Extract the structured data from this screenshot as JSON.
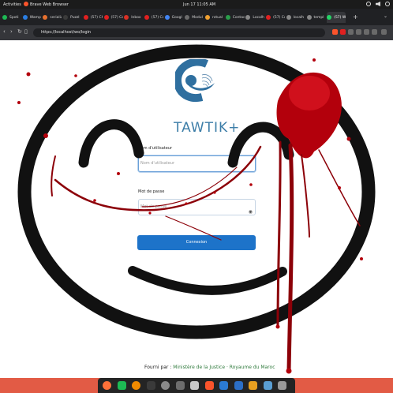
{
  "topbar": {
    "activities": "Activities",
    "app_name": "Brave Web Browser",
    "clock": "Jun 17  11:05 AM"
  },
  "tabs": [
    {
      "label": "Spoti",
      "color": "#1db954"
    },
    {
      "label": "Wamp",
      "color": "#2a7de1"
    },
    {
      "label": "serializ",
      "color": "#e6702e"
    },
    {
      "label": "Puzzl",
      "color": "#3b3b3b"
    },
    {
      "label": "(57) Ch",
      "color": "#e02020"
    },
    {
      "label": "(57) Co",
      "color": "#e02020"
    },
    {
      "label": "Inbox",
      "color": "#d93025"
    },
    {
      "label": "(57) Co",
      "color": "#e02020"
    },
    {
      "label": "Googl",
      "color": "#4285f4"
    },
    {
      "label": "Modul",
      "color": "#6b6b6b"
    },
    {
      "label": "rxtual",
      "color": "#f0a030"
    },
    {
      "label": "Contac",
      "color": "#2a9d4a"
    },
    {
      "label": "Localh",
      "color": "#888888"
    },
    {
      "label": "(57) Cc",
      "color": "#e02020"
    },
    {
      "label": "localh",
      "color": "#888888"
    },
    {
      "label": "templ",
      "color": "#888888"
    },
    {
      "label": "(57) Wh",
      "color": "#25d366"
    }
  ],
  "address": {
    "url": "https://localhost/wo/login"
  },
  "logo": {
    "brand": "TAWTIK+"
  },
  "form": {
    "username_label": "Nom d'utilisateur",
    "username_placeholder": "Nom d'utilisateur",
    "password_label": "Mot de passe",
    "password_placeholder": "Mot de passe",
    "submit_label": "Connexion"
  },
  "footer": {
    "prefix": "Fourni par :",
    "link": "Ministère de la Justice · Royaume du Maroc"
  },
  "colors": {
    "accent": "#1d73c9",
    "brand": "#3d7ea8",
    "dock_bg": "#242424",
    "dock_strip": "#e25b45",
    "blood": "#b3000c"
  },
  "dock_icons": [
    "firefox-icon",
    "spotify-icon",
    "vlc-icon",
    "terminal-icon",
    "files-icon",
    "settings-icon",
    "software-icon",
    "brave-icon",
    "vscode-icon",
    "documents-icon",
    "image-viewer-icon",
    "text-editor-icon",
    "apps-grid-icon"
  ]
}
